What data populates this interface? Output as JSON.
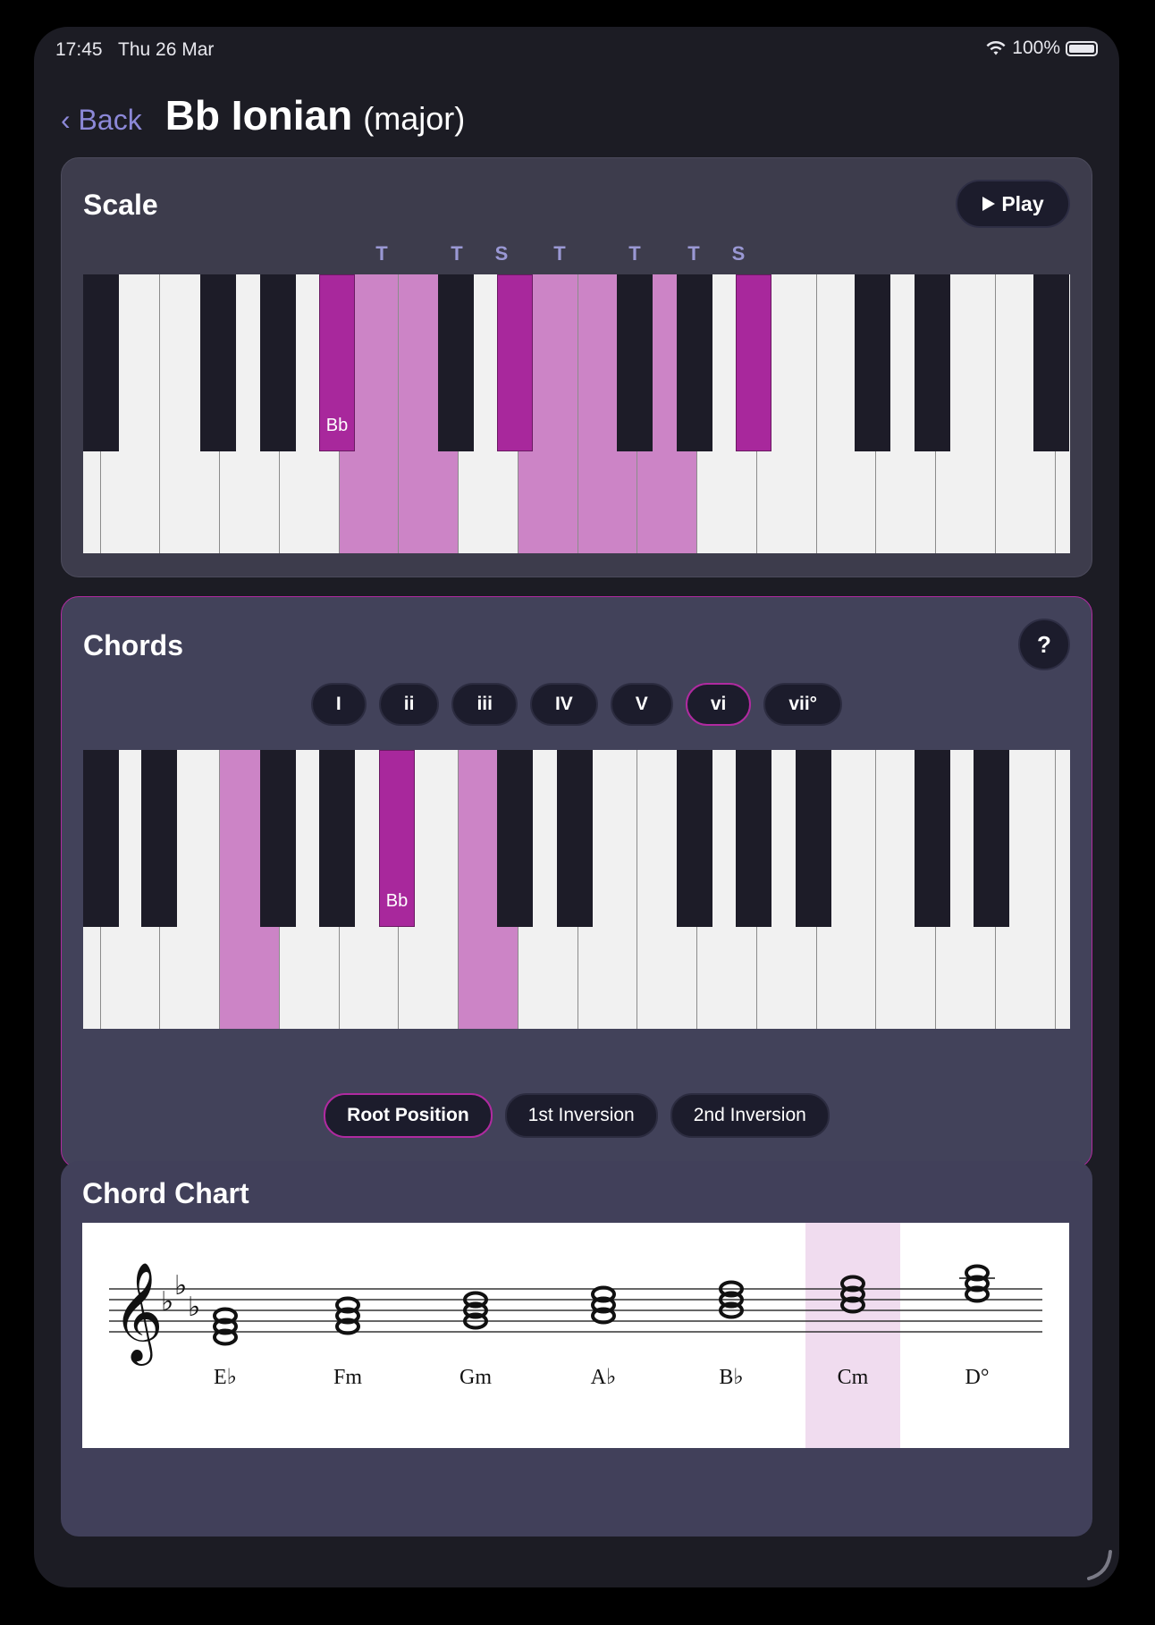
{
  "status": {
    "time": "17:45",
    "date": "Thu 26 Mar",
    "battery": "100%",
    "wifi_icon": "wifi-icon",
    "battery_icon": "battery-icon"
  },
  "header": {
    "back_label": "‹ Back",
    "title": "Bb Ionian",
    "subtitle": "(major)"
  },
  "scale": {
    "heading": "Scale",
    "play_label": "Play",
    "play_icon": "play-icon",
    "steps": [
      "T",
      "T",
      "S",
      "T",
      "T",
      "T",
      "S"
    ],
    "root_label": "Bb"
  },
  "chords": {
    "heading": "Chords",
    "help_label": "?",
    "degrees": [
      "I",
      "ii",
      "iii",
      "IV",
      "V",
      "vi",
      "vii°"
    ],
    "selected_degree": "vi",
    "root_label": "Bb",
    "inversions": [
      "Root Position",
      "1st Inversion",
      "2nd Inversion"
    ],
    "selected_inversion": "Root Position"
  },
  "chord_chart": {
    "heading": "Chord Chart",
    "chord_names": [
      "E♭",
      "Fm",
      "Gm",
      "A♭",
      "B♭",
      "Cm",
      "D°"
    ],
    "highlighted": "Cm",
    "key_signature": "3 flats",
    "clef": "treble"
  },
  "colors": {
    "accent": "#b02aa0",
    "highlight_light": "#cc84c6",
    "highlight_dark": "#a8289c",
    "link": "#8c88d8",
    "background": "#1c1c24"
  }
}
